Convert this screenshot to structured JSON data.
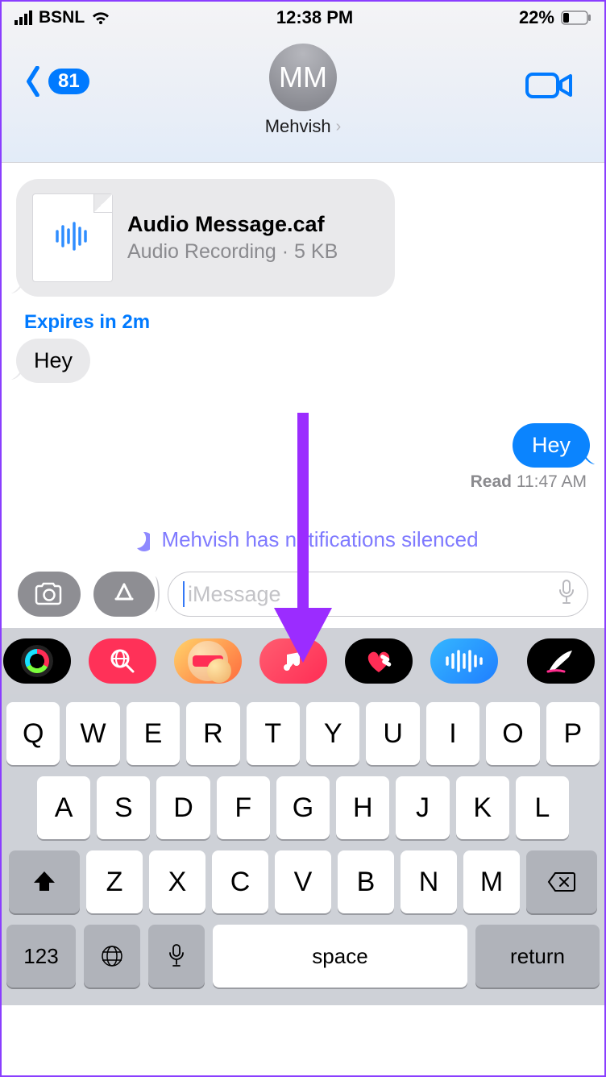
{
  "status": {
    "carrier": "BSNL",
    "time": "12:38 PM",
    "battery_text": "22%"
  },
  "nav": {
    "back_badge": "81",
    "avatar_initials": "MM",
    "contact_name": "Mehvish"
  },
  "messages": {
    "audio_file": {
      "title": "Audio Message.caf",
      "subtitle": "Audio Recording · 5 KB"
    },
    "expiry": "Expires in 2m",
    "incoming_text": "Hey",
    "outgoing_text": "Hey",
    "receipt_status": "Read",
    "receipt_time": "11:47 AM",
    "silenced_text": "Mehvish has notifications silenced"
  },
  "compose": {
    "placeholder": "iMessage"
  },
  "apps": {
    "activity": "activity",
    "hashtag": "images-search",
    "memoji": "memoji",
    "music": "music",
    "heart": "digital-touch",
    "wave": "audio",
    "pencil": "draw"
  },
  "keyboard": {
    "row1": [
      "Q",
      "W",
      "E",
      "R",
      "T",
      "Y",
      "U",
      "I",
      "O",
      "P"
    ],
    "row2": [
      "A",
      "S",
      "D",
      "F",
      "G",
      "H",
      "J",
      "K",
      "L"
    ],
    "row3": [
      "Z",
      "X",
      "C",
      "V",
      "B",
      "N",
      "M"
    ],
    "num": "123",
    "space": "space",
    "return": "return"
  }
}
